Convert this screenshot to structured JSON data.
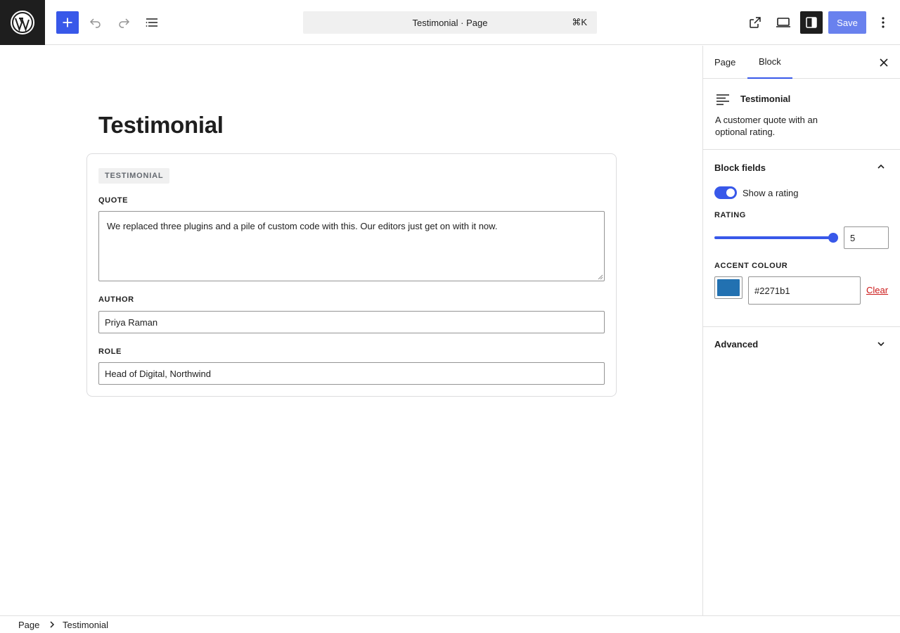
{
  "header": {
    "document_title": "Testimonial · Page",
    "shortcut": "⌘K",
    "save_label": "Save",
    "icons": {
      "logo": "wordpress-logo-icon",
      "add": "plus-icon",
      "undo": "undo-icon",
      "redo": "redo-icon",
      "list_view": "list-view-icon",
      "view": "external-link-icon",
      "preview": "desktop-preview-icon",
      "settings": "sidebar-settings-icon",
      "options": "more-vertical-icon"
    }
  },
  "editor": {
    "page_title": "Testimonial",
    "block": {
      "badge": "TESTIMONIAL",
      "fields": {
        "quote": {
          "label": "QUOTE",
          "value": "We replaced three plugins and a pile of custom code with this. Our editors just get on with it now."
        },
        "author": {
          "label": "AUTHOR",
          "value": "Priya Raman"
        },
        "role": {
          "label": "ROLE",
          "value": "Head of Digital, Northwind"
        }
      }
    }
  },
  "sidebar": {
    "tabs": [
      {
        "label": "Page",
        "active": false
      },
      {
        "label": "Block",
        "active": true
      }
    ],
    "block_card": {
      "title": "Testimonial",
      "description": "A customer quote with an optional rating."
    },
    "block_fields_panel": {
      "title": "Block fields",
      "expanded": true,
      "show_rating": {
        "label": "Show a rating",
        "checked": true
      },
      "rating": {
        "label": "RATING",
        "value": "5",
        "min": 0,
        "max": 5,
        "fill_fraction": 1.0
      },
      "accent_colour": {
        "label": "ACCENT COLOUR",
        "value": "#2271b1",
        "clear_label": "Clear"
      }
    },
    "advanced_panel": {
      "title": "Advanced",
      "expanded": false
    }
  },
  "footer": {
    "breadcrumbs": [
      "Page",
      "Testimonial"
    ]
  },
  "colors": {
    "accent": "#3858e9",
    "swatch": "#2271b1",
    "danger": "#cc1818",
    "dark": "#1e1e1e"
  }
}
